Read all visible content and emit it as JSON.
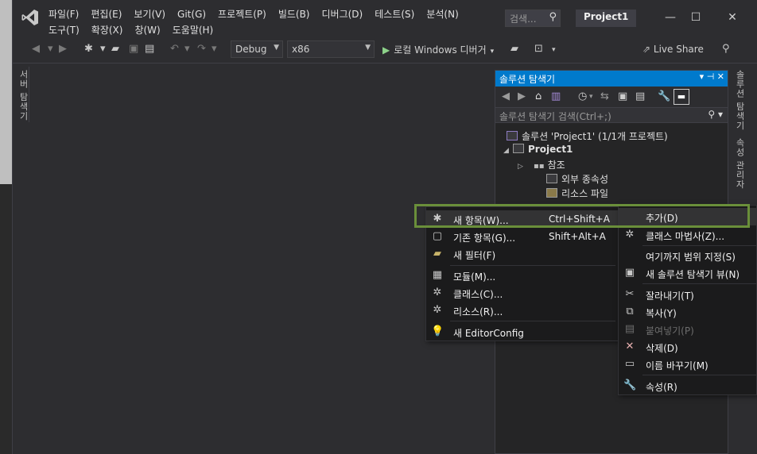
{
  "menubar": {
    "row1": [
      "파일(F)",
      "편집(E)",
      "보기(V)",
      "Git(G)",
      "프로젝트(P)",
      "빌드(B)",
      "디버그(D)",
      "테스트(S)",
      "분석(N)"
    ],
    "row2": [
      "도구(T)",
      "확장(X)",
      "창(W)",
      "도움말(H)"
    ],
    "search_placeholder": "검색...",
    "project_title": "Project1"
  },
  "window_controls": {
    "minimize": "—",
    "maximize": "☐",
    "close": "✕"
  },
  "toolbar": {
    "config": "Debug",
    "platform": "x86",
    "run_label": "로컬 Windows 디버거",
    "live_share": "Live Share"
  },
  "left_tab": "서버 탐색기",
  "right_tabs": [
    "솔루션 탐색기",
    "속성 관리자"
  ],
  "solution_explorer": {
    "title": "솔루션 탐색기",
    "search_placeholder": "솔루션 탐색기 검색(Ctrl+;)",
    "tree": [
      {
        "label": "솔루션 'Project1' (1/1개 프로젝트)"
      },
      {
        "label": "Project1",
        "bold": true
      },
      {
        "label": "참조"
      },
      {
        "label": "외부 종속성"
      },
      {
        "label": "리소스 파일"
      }
    ]
  },
  "add_submenu": {
    "items": [
      {
        "label": "새 항목(W)...",
        "shortcut": "Ctrl+Shift+A"
      },
      {
        "label": "기존 항목(G)...",
        "shortcut": "Shift+Alt+A"
      },
      {
        "label": "새 필터(F)",
        "shortcut": ""
      },
      {
        "label": "모듈(M)...",
        "shortcut": ""
      },
      {
        "label": "클래스(C)...",
        "shortcut": ""
      },
      {
        "label": "리소스(R)...",
        "shortcut": ""
      },
      {
        "label": "새 EditorConfig",
        "shortcut": ""
      }
    ]
  },
  "context_menu": {
    "items": [
      {
        "label": "추가(D)"
      },
      {
        "label": "클래스 마법사(Z)..."
      },
      {
        "label": "여기까지 범위 지정(S)"
      },
      {
        "label": "새 솔루션 탐색기 뷰(N)"
      },
      {
        "label": "잘라내기(T)"
      },
      {
        "label": "복사(Y)"
      },
      {
        "label": "붙여넣기(P)",
        "disabled": true
      },
      {
        "label": "삭제(D)"
      },
      {
        "label": "이름 바꾸기(M)"
      },
      {
        "label": "속성(R)"
      }
    ]
  }
}
